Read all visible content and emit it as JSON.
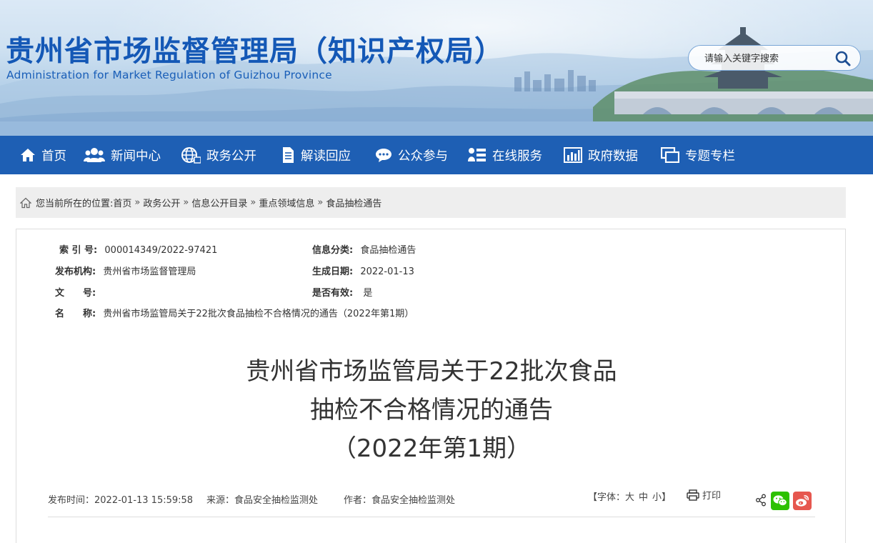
{
  "header": {
    "title": "贵州省市场监督管理局（知识产权局）",
    "subtitle": "Administration for Market Regulation of Guizhou Province",
    "search_placeholder": "请输入关键字搜索"
  },
  "nav": {
    "items": [
      {
        "label": "首页",
        "icon": "home-icon"
      },
      {
        "label": "新闻中心",
        "icon": "people-icon"
      },
      {
        "label": "政务公开",
        "icon": "globe-icon"
      },
      {
        "label": "解读回应",
        "icon": "document-icon"
      },
      {
        "label": "公众参与",
        "icon": "chat-icon"
      },
      {
        "label": "在线服务",
        "icon": "service-icon"
      },
      {
        "label": "政府数据",
        "icon": "bar-chart-icon"
      },
      {
        "label": "专题专栏",
        "icon": "window-icon"
      }
    ]
  },
  "breadcrumb": {
    "prefix": "您当前所在的位置:",
    "items": [
      "首页",
      "政务公开",
      "信息公开目录",
      "重点领域信息",
      "食品抽检通告"
    ],
    "separator": "»"
  },
  "meta": {
    "index_label": "索 引 号:",
    "index_value": "000014349/2022-97421",
    "category_label": "信息分类:",
    "category_value": "食品抽检通告",
    "publisher_label": "发布机构:",
    "publisher_value": "贵州省市场监督管理局",
    "date_label": "生成日期:",
    "date_value": "2022-01-13",
    "docno_label": "文　　号:",
    "docno_value": "",
    "valid_label": "是否有效:",
    "valid_value": "是",
    "name_label": "名　　称:",
    "name_value": "贵州省市场监管局关于22批次食品抽检不合格情况的通告（2022年第1期）"
  },
  "article": {
    "title_line1": "贵州省市场监管局关于22批次食品",
    "title_line2": "抽检不合格情况的通告",
    "title_line3": "（2022年第1期）",
    "published": "发布时间：2022-01-13 15:59:58",
    "source": "来源：食品安全抽检监测处",
    "author": "作者：食品安全抽检监测处"
  },
  "tools": {
    "font_prefix": "【字体：",
    "font_large": "大",
    "font_medium": "中",
    "font_small": "小",
    "font_suffix": "】",
    "print_label": "打印"
  },
  "colors": {
    "nav_bg": "#1e5fb4",
    "title_blue": "#1458b6",
    "wechat_green": "#2dc100",
    "weibo_red": "#e6574f"
  }
}
